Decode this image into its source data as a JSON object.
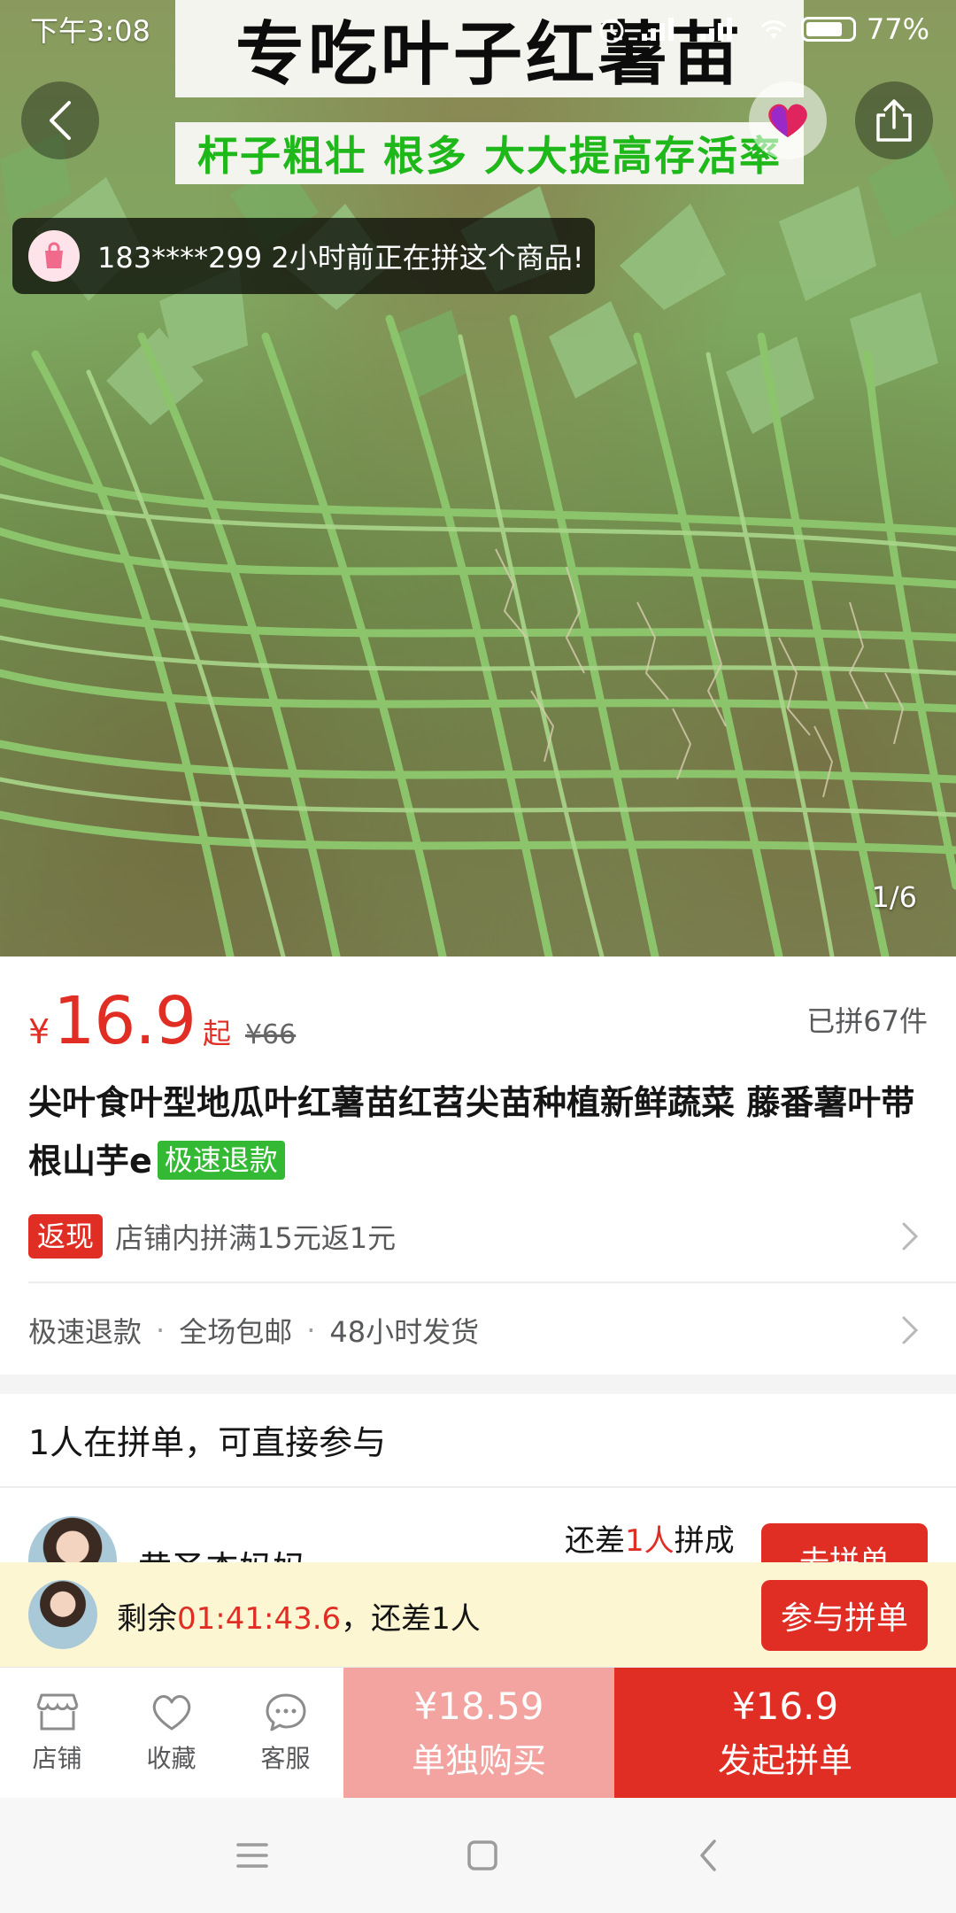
{
  "status_bar": {
    "time": "下午3:08",
    "battery": "77%"
  },
  "hero": {
    "banner_title": "专吃叶子红薯苗",
    "banner_subtitle": "杆子粗壮 根多 大大提高存活率",
    "notice": "183****299 2小时前正在拼这个商品!",
    "pager": "1/6"
  },
  "product": {
    "currency": "¥",
    "price": "16.9",
    "price_suffix": "起",
    "original_price": "¥66",
    "sold": "已拼67件",
    "title": "尖叶食叶型地瓜叶红薯苗红苕尖苗种植新鲜蔬菜 藤番薯叶带根山芋e",
    "title_tag": "极速退款"
  },
  "promo": {
    "badge": "返现",
    "text": "店铺内拼满15元返1元"
  },
  "services": [
    "极速退款",
    "全场包邮",
    "48小时发货"
  ],
  "group": {
    "heading": "1人在拼单，可直接参与",
    "row": {
      "name": "黄圣杰妈妈",
      "need_prefix": "还差",
      "need_count": "1人",
      "need_suffix": "拼成",
      "button": "去拼单"
    }
  },
  "floating": {
    "prefix": "剩余",
    "timer": "01:41:43.6",
    "suffix": "，还差1人",
    "button": "参与拼单"
  },
  "action_bar": {
    "shop": "店铺",
    "favorite": "收藏",
    "service": "客服",
    "alone_price": "¥18.59",
    "alone_label": "单独购买",
    "group_price": "¥16.9",
    "group_label": "发起拼单"
  },
  "colors": {
    "accent": "#e02e24",
    "success_tag": "#34b935",
    "sub_banner_green": "#1fb81a"
  }
}
